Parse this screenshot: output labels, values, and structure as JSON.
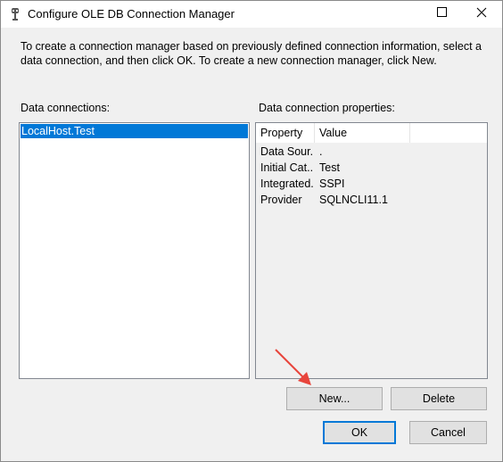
{
  "window": {
    "title": "Configure OLE DB Connection Manager",
    "icon": "database-plug-icon",
    "controls": {
      "maximize_icon": "maximize-icon",
      "close_icon": "close-icon"
    }
  },
  "description": "To create a connection manager based on previously defined connection information, select a data connection, and then click OK. To create a new connection manager, click New.",
  "connections": {
    "label": "Data connections:",
    "items": [
      {
        "label": "LocalHost.Test",
        "selected": true
      }
    ]
  },
  "properties": {
    "label": "Data connection properties:",
    "columns": [
      "Property",
      "Value"
    ],
    "rows": [
      {
        "property": "Data Sour...",
        "value": "."
      },
      {
        "property": "Initial Cat...",
        "value": "Test"
      },
      {
        "property": "Integrated...",
        "value": "SSPI"
      },
      {
        "property": "Provider",
        "value": "SQLNCLI11.1"
      }
    ]
  },
  "buttons": {
    "new": "New...",
    "delete": "Delete",
    "ok": "OK",
    "cancel": "Cancel"
  },
  "colors": {
    "selection": "#0078d7",
    "annotation_arrow": "#e8453c",
    "dialog_bg": "#f0f0f0"
  }
}
